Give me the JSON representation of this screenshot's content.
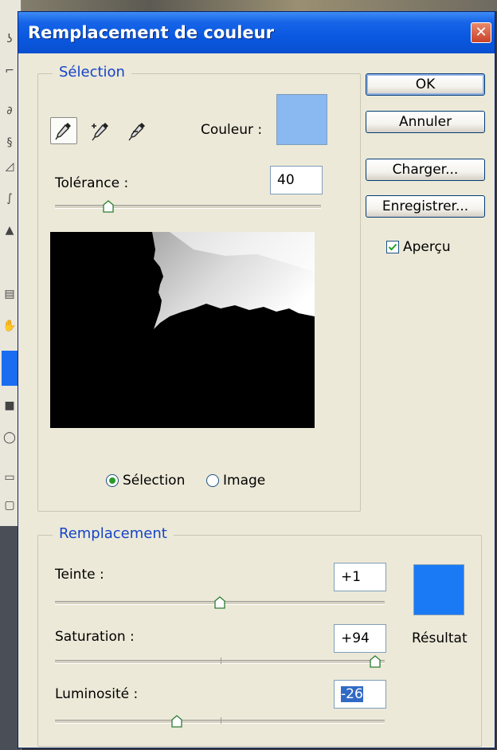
{
  "dialog": {
    "title": "Remplacement de couleur",
    "close_glyph": "✕"
  },
  "selection": {
    "group_title": "Sélection",
    "couleur_label": "Couleur :",
    "couleur_swatch": "#8ab8f0",
    "tolerance_label": "Tolérance :",
    "tolerance_value": "40",
    "tolerance_fraction": 0.2,
    "eyedroppers": [
      "eyedropper-icon",
      "eyedropper-plus-icon",
      "eyedropper-minus-icon"
    ],
    "radio_selection_label": "Sélection",
    "radio_image_label": "Image",
    "radio_selected": "Sélection"
  },
  "buttons": {
    "ok": "OK",
    "cancel": "Annuler",
    "load": "Charger...",
    "save": "Enregistrer..."
  },
  "apercu": {
    "label": "Aperçu",
    "checked": true
  },
  "replacement": {
    "group_title": "Remplacement",
    "teinte_label": "Teinte :",
    "teinte_value": "+1",
    "teinte_fraction": 0.5,
    "saturation_label": "Saturation :",
    "saturation_value": "+94",
    "saturation_fraction": 0.97,
    "luminosite_label": "Luminosité :",
    "luminosite_value": "-26",
    "luminosite_fraction": 0.37,
    "result_label": "Résultat",
    "result_swatch": "#1a7af5"
  }
}
